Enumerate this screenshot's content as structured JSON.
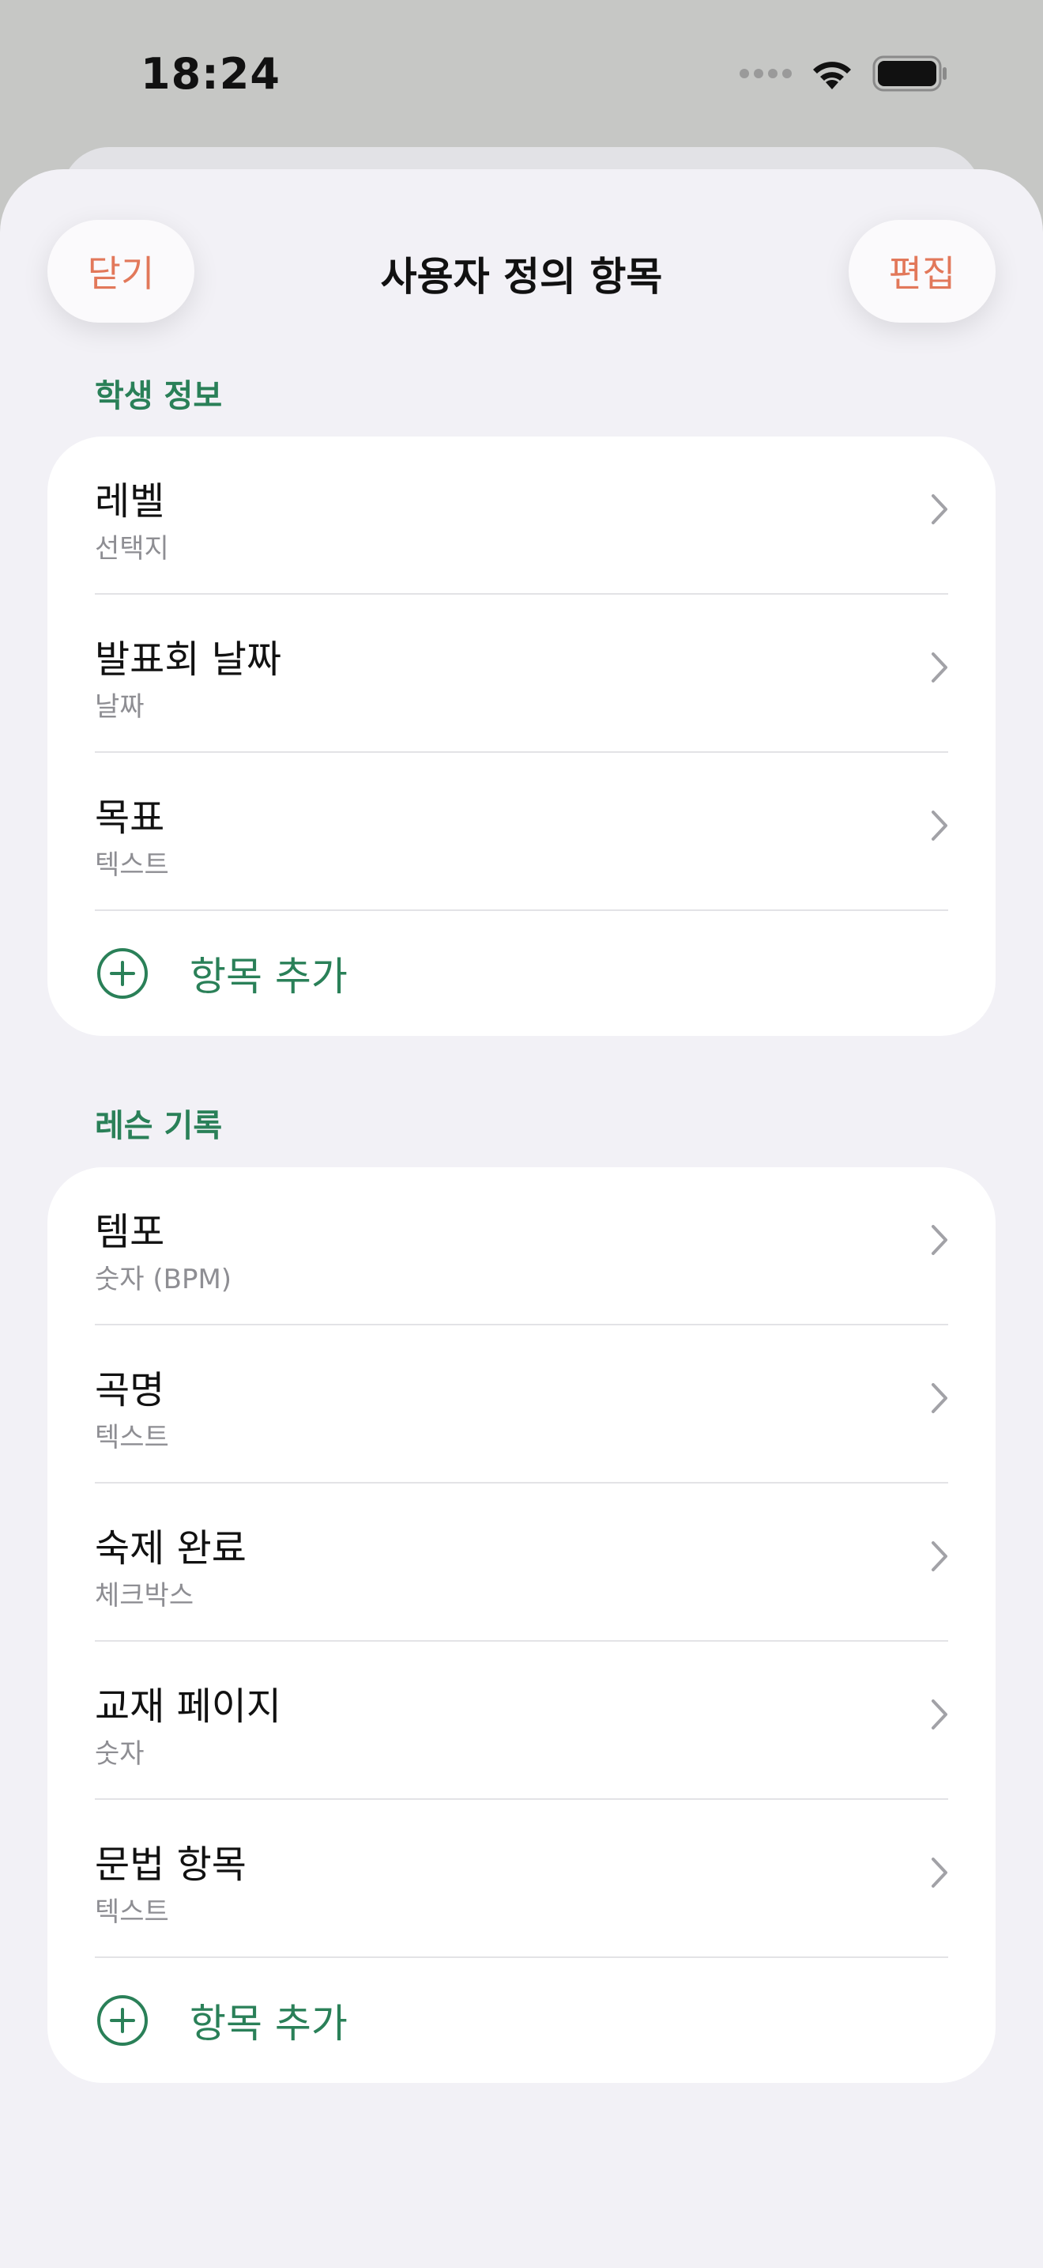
{
  "status_bar": {
    "time": "18:24"
  },
  "nav": {
    "title": "사용자 정의 항목",
    "close_label": "닫기",
    "edit_label": "편집"
  },
  "sections": [
    {
      "header": "학생 정보",
      "rows": [
        {
          "title": "레벨",
          "type": "선택지"
        },
        {
          "title": "발표회 날짜",
          "type": "날짜"
        },
        {
          "title": "목표",
          "type": "텍스트"
        }
      ],
      "add_label": "항목 추가"
    },
    {
      "header": "레슨 기록",
      "rows": [
        {
          "title": "템포",
          "type": "숫자 (BPM)"
        },
        {
          "title": "곡명",
          "type": "텍스트"
        },
        {
          "title": "숙제 완료",
          "type": "체크박스"
        },
        {
          "title": "교재 페이지",
          "type": "숫자"
        },
        {
          "title": "문법 항목",
          "type": "텍스트"
        }
      ],
      "add_label": "항목 추가"
    }
  ],
  "icons": {
    "chevron": "chevron-right-icon",
    "add": "plus-circle-icon",
    "wifi": "wifi-icon",
    "battery": "battery-icon"
  },
  "colors": {
    "accent_orange": "#e2785a",
    "accent_green": "#2a8058",
    "sheet_bg": "#f2f1f6"
  }
}
